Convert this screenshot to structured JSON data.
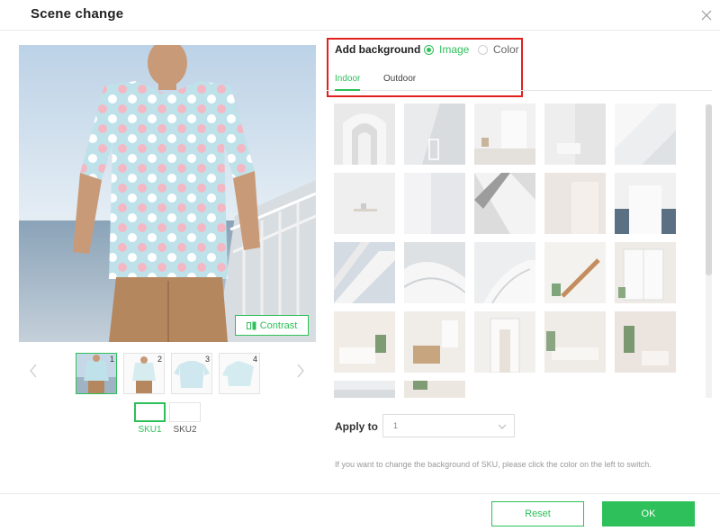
{
  "dialog": {
    "title": "Scene change"
  },
  "preview": {
    "contrast_label": "Contrast",
    "thumbnails": [
      "1",
      "2",
      "3",
      "4"
    ],
    "selected_thumbnail": "1"
  },
  "skus": {
    "items": [
      {
        "label": "SKU1",
        "selected": true
      },
      {
        "label": "SKU2",
        "selected": false
      }
    ]
  },
  "background": {
    "label": "Add background",
    "options": [
      "Image",
      "Color"
    ],
    "selected": "Image"
  },
  "tabs": {
    "items": [
      "Indoor",
      "Outdoor"
    ],
    "active": "Indoor"
  },
  "apply": {
    "label": "Apply to",
    "value": "1"
  },
  "hint": {
    "text": "If you want to change the background of SKU, please click the color on the left to switch."
  },
  "footer": {
    "reset_label": "Reset",
    "ok_label": "OK"
  },
  "colors": {
    "accent": "#2ec05a",
    "highlight_border": "#e0211d"
  }
}
